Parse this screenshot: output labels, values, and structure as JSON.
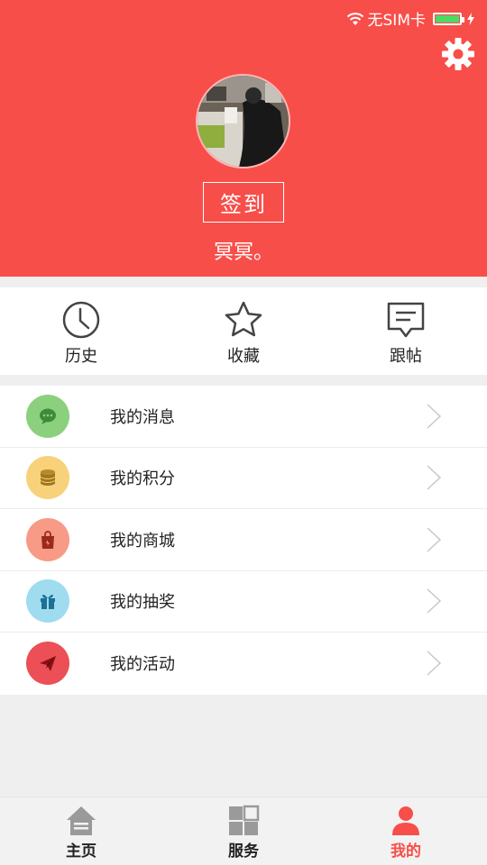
{
  "status_bar": {
    "carrier": "无SIM卡",
    "battery_level": 1.0
  },
  "profile": {
    "sign_in_label": "签到",
    "username": "冥冥。"
  },
  "quick_actions": [
    {
      "label": "历史",
      "icon": "clock-icon"
    },
    {
      "label": "收藏",
      "icon": "star-icon"
    },
    {
      "label": "跟帖",
      "icon": "comment-icon"
    }
  ],
  "menu": [
    {
      "label": "我的消息",
      "icon": "chat-icon",
      "color": "#8bd07d"
    },
    {
      "label": "我的积分",
      "icon": "coins-icon",
      "color": "#f7d27a"
    },
    {
      "label": "我的商城",
      "icon": "shopping-bag-icon",
      "color": "#f79a86"
    },
    {
      "label": "我的抽奖",
      "icon": "gift-icon",
      "color": "#9fdcf0"
    },
    {
      "label": "我的活动",
      "icon": "paper-plane-icon",
      "color": "#ec4f55"
    }
  ],
  "tabs": [
    {
      "label": "主页",
      "icon": "home-icon",
      "active": false
    },
    {
      "label": "服务",
      "icon": "grid-icon",
      "active": false
    },
    {
      "label": "我的",
      "icon": "person-icon",
      "active": true
    }
  ],
  "colors": {
    "accent": "#f84e49"
  }
}
